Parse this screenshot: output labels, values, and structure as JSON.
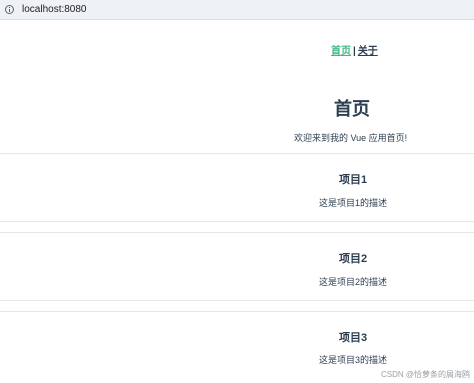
{
  "browser": {
    "url": "localhost:8080"
  },
  "nav": {
    "home_label": "首页",
    "separator": "|",
    "about_label": "关于"
  },
  "page": {
    "title": "首页",
    "welcome": "欢迎来到我的 Vue 应用首页!"
  },
  "items": [
    {
      "title": "项目1",
      "description": "这是项目1的描述"
    },
    {
      "title": "项目2",
      "description": "这是项目2的描述"
    },
    {
      "title": "项目3",
      "description": "这是项目3的描述"
    }
  ],
  "watermark": "CSDN @恰萝条的屑海鸥",
  "colors": {
    "accent": "#42b983",
    "text": "#2c3e50",
    "divider": "#e6e6e6"
  }
}
